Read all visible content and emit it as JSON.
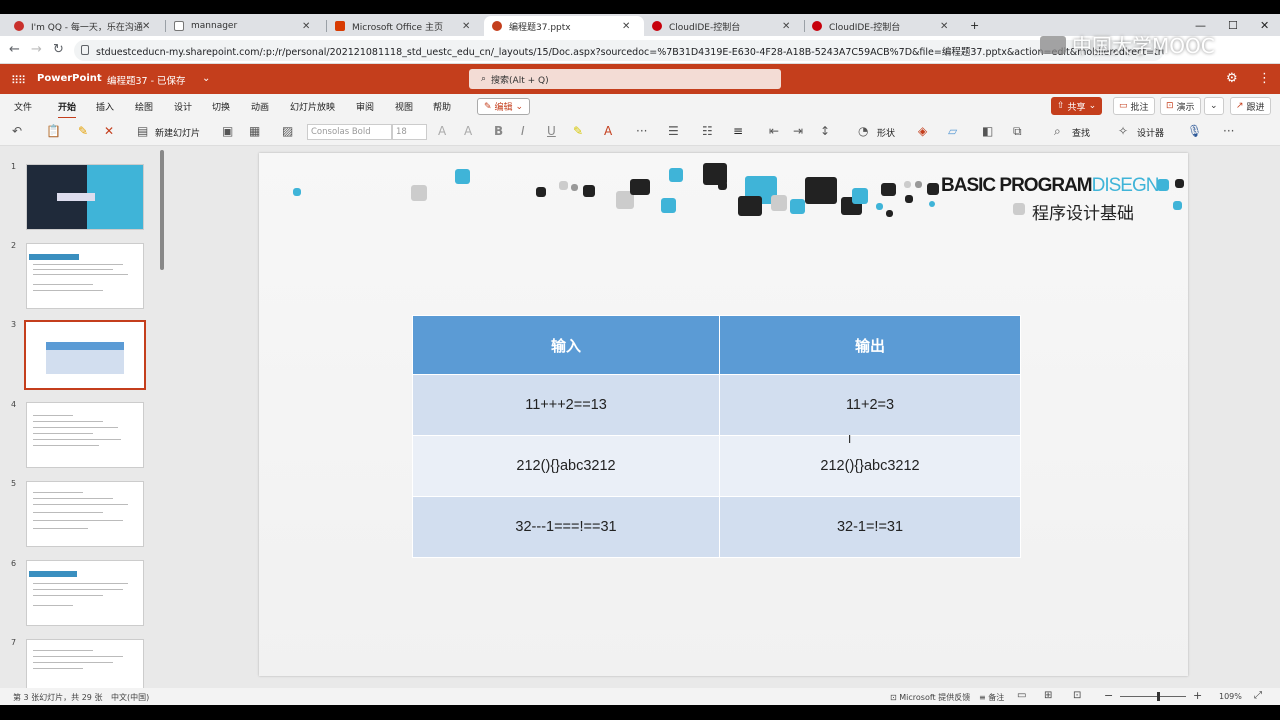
{
  "browser": {
    "tabs": [
      {
        "title": "I'm QQ - 每一天，乐在沟通",
        "color": "#c9302c"
      },
      {
        "title": "mannager",
        "color": "#777777"
      },
      {
        "title": "Microsoft Office 主页",
        "color": "#d83b01"
      },
      {
        "title": "编程题37.pptx",
        "color": "#c43e1c"
      },
      {
        "title": "CloudIDE-控制台",
        "color": "#c7000b"
      },
      {
        "title": "CloudIDE-控制台",
        "color": "#c7000b"
      }
    ],
    "url": "stduestceducn-my.sharepoint.com/:p:/r/personal/202121081118_std_uestc_edu_cn/_layouts/15/Doc.aspx?sourcedoc=%7B31D4319E-E630-4F28-A18B-5243A7C59ACB%7D&file=编程题37.pptx&action=edit&mobileredirect=true&..."
  },
  "watermark": "中国大学MOOC",
  "app": {
    "name": "PowerPoint",
    "doc_title": "编程题37 - 已保存",
    "search_placeholder": "搜索(Alt + Q)",
    "brand_color": "#c43e1c"
  },
  "ribbon_tabs": [
    "文件",
    "开始",
    "插入",
    "绘图",
    "设计",
    "切换",
    "动画",
    "幻灯片放映",
    "审阅",
    "视图",
    "帮助"
  ],
  "edit_mode": "编辑",
  "actions": {
    "share": "共享",
    "comment": "批注",
    "present": "演示",
    "catchup": "跟进"
  },
  "toolbar": {
    "new_slide": "新建幻灯片",
    "font_name": "Consolas Bold",
    "font_size": "18",
    "shapes": "形状",
    "find": "查找",
    "designer": "设计器"
  },
  "thumbnails": [
    "1",
    "2",
    "3",
    "4",
    "5",
    "6",
    "7"
  ],
  "slide": {
    "brand_en_main": "BASIC PROGRAM",
    "brand_en_accent": "DISEGN",
    "brand_cn": "程序设计基础",
    "table": {
      "headers": [
        "输入",
        "输出"
      ],
      "rows": [
        [
          "11+++2==13",
          "11+2=3"
        ],
        [
          "212(){}abc3212",
          "212(){}abc3212"
        ],
        [
          "32---1===!==31",
          "32-1=!=31"
        ]
      ]
    }
  },
  "status": {
    "slide_info": "第 3 张幻灯片，共 29 张",
    "language": "中文(中国)",
    "feedback": "Microsoft 提供反馈",
    "notes": "备注",
    "zoom": "109%"
  }
}
